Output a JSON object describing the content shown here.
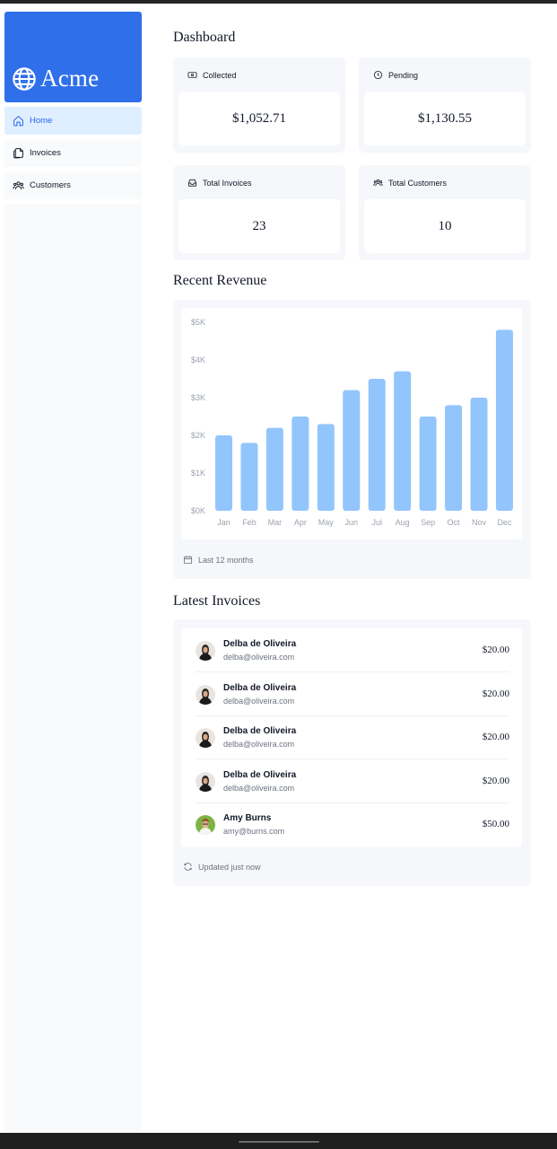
{
  "brand": {
    "name": "Acme",
    "color": "#2f6fea",
    "icon": "globe-icon"
  },
  "sidebar": {
    "items": [
      {
        "label": "Home",
        "icon": "home-icon",
        "active": true
      },
      {
        "label": "Invoices",
        "icon": "documents-icon",
        "active": false
      },
      {
        "label": "Customers",
        "icon": "users-icon",
        "active": false
      }
    ]
  },
  "dashboard": {
    "title": "Dashboard",
    "cards": [
      {
        "title": "Collected",
        "value": "$1,052.71",
        "icon": "banknote-icon"
      },
      {
        "title": "Pending",
        "value": "$1,130.55",
        "icon": "clock-icon"
      },
      {
        "title": "Total Invoices",
        "value": "23",
        "icon": "inbox-icon"
      },
      {
        "title": "Total Customers",
        "value": "10",
        "icon": "users-icon"
      }
    ]
  },
  "revenue": {
    "title": "Recent Revenue",
    "footer": "Last 12 months",
    "footer_icon": "calendar-icon"
  },
  "chart_data": {
    "type": "bar",
    "categories": [
      "Jan",
      "Feb",
      "Mar",
      "Apr",
      "May",
      "Jun",
      "Jul",
      "Aug",
      "Sep",
      "Oct",
      "Nov",
      "Dec"
    ],
    "values": [
      2000,
      1800,
      2200,
      2500,
      2300,
      3200,
      3500,
      3700,
      2500,
      2800,
      3000,
      4800
    ],
    "y_ticks": [
      "$0K",
      "$1K",
      "$2K",
      "$3K",
      "$4K",
      "$5K"
    ],
    "ylim": [
      0,
      5000
    ],
    "bar_color": "#93c5fd",
    "grid": false
  },
  "invoices": {
    "title": "Latest Invoices",
    "footer": "Updated just now",
    "footer_icon": "refresh-icon",
    "rows": [
      {
        "name": "Delba de Oliveira",
        "email": "delba@oliveira.com",
        "amount": "$20.00",
        "avatar": "avatar-delba"
      },
      {
        "name": "Delba de Oliveira",
        "email": "delba@oliveira.com",
        "amount": "$20.00",
        "avatar": "avatar-delba"
      },
      {
        "name": "Delba de Oliveira",
        "email": "delba@oliveira.com",
        "amount": "$20.00",
        "avatar": "avatar-delba"
      },
      {
        "name": "Delba de Oliveira",
        "email": "delba@oliveira.com",
        "amount": "$20.00",
        "avatar": "avatar-delba"
      },
      {
        "name": "Amy Burns",
        "email": "amy@burns.com",
        "amount": "$50.00",
        "avatar": "avatar-amy"
      }
    ]
  }
}
